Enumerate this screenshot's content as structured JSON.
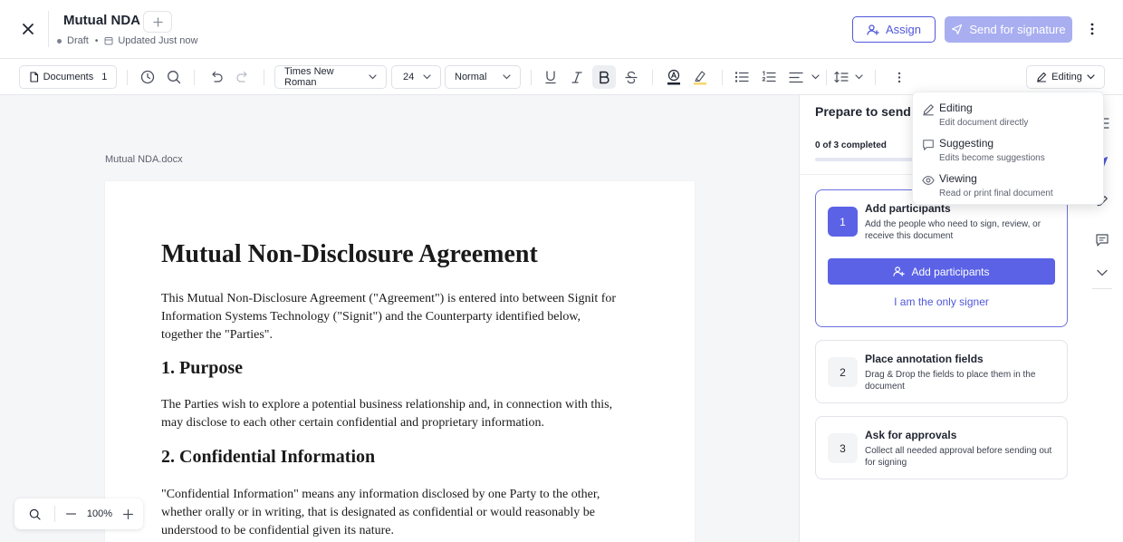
{
  "header": {
    "title": "Mutual NDA",
    "status": "Draft",
    "updated": "Updated Just now",
    "assign_label": "Assign",
    "send_label": "Send for signature"
  },
  "toolbar": {
    "documents_label": "Documents",
    "documents_count": "1",
    "font_family": "Times New Roman",
    "font_size": "24",
    "text_style": "Normal",
    "mode_label": "Editing"
  },
  "document": {
    "file_name": "Mutual NDA.docx",
    "title": "Mutual Non-Disclosure Agreement",
    "intro": "This Mutual Non-Disclosure Agreement (\"Agreement\") is entered into between Signit for Information Systems Technology (\"Signit\") and the Counterparty identified below, together the \"Parties\".",
    "h_purpose": "1. Purpose",
    "p_purpose": "The Parties wish to explore a potential business relationship and, in connection with this, may disclose to each other certain confidential and proprietary information.",
    "h_confidential": "2. Confidential Information",
    "p_confidential": "\"Confidential Information\" means any information disclosed by one Party to the other, whether orally or in writing, that is designated as confidential or would reasonably be understood to be confidential given its nature."
  },
  "zoom": {
    "value": "100%"
  },
  "panel": {
    "title": "Prepare to send",
    "progress_text": "0 of 3 completed",
    "progress_fraction": 0.0,
    "steps": [
      {
        "num": "1",
        "title": "Add participants",
        "desc": "Add the people who need to sign, review, or receive this document",
        "button_label": "Add participants",
        "link_label": "I am the only signer"
      },
      {
        "num": "2",
        "title": "Place annotation fields",
        "desc": "Drag & Drop the fields to place them in the document"
      },
      {
        "num": "3",
        "title": "Ask for approvals",
        "desc": "Collect all needed approval before sending out for signing"
      }
    ]
  },
  "mode_menu": {
    "items": [
      {
        "label": "Editing",
        "desc": "Edit document directly",
        "icon": "pencil-icon"
      },
      {
        "label": "Suggesting",
        "desc": "Edits become suggestions",
        "icon": "comment-icon"
      },
      {
        "label": "Viewing",
        "desc": "Read or print final document",
        "icon": "eye-icon"
      }
    ]
  },
  "colors": {
    "accent": "#4f57d9",
    "accent_fill": "#5b62e6",
    "send_disabled": "#a8aef0",
    "canvas_bg": "#f5f6f8"
  }
}
